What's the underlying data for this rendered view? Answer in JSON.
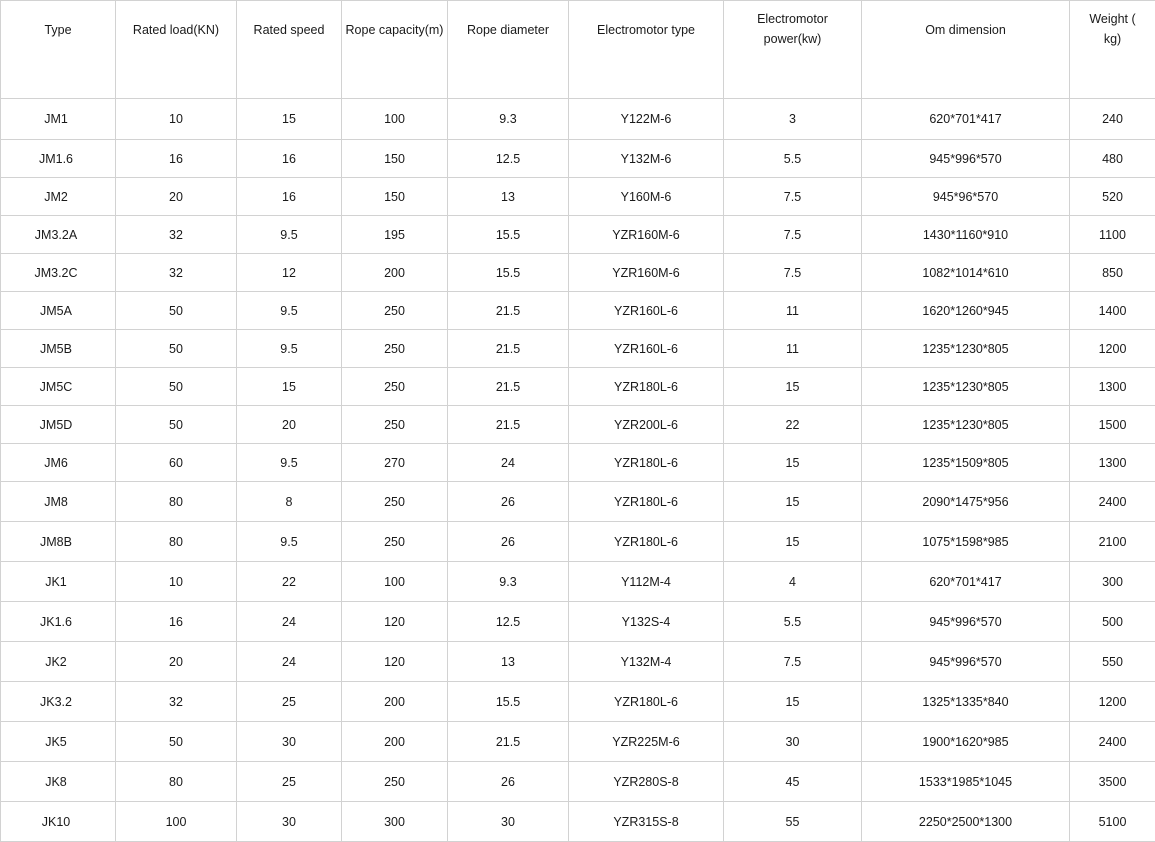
{
  "table": {
    "headers": [
      "Type",
      "Rated load(KN)",
      "Rated speed",
      "Rope capacity(m)",
      "Rope diameter",
      "Electromotor type",
      "Electromotor power(kw)",
      "Om dimension",
      "Weight ( kg)"
    ],
    "rows": [
      [
        "JM1",
        "10",
        "15",
        "100",
        "9.3",
        "Y122M-6",
        "3",
        "620*701*417",
        "240"
      ],
      [
        "JM1.6",
        "16",
        "16",
        "150",
        "12.5",
        "Y132M-6",
        "5.5",
        "945*996*570",
        "480"
      ],
      [
        "JM2",
        "20",
        "16",
        "150",
        "13",
        "Y160M-6",
        "7.5",
        "945*96*570",
        "520"
      ],
      [
        "JM3.2A",
        "32",
        "9.5",
        "195",
        "15.5",
        "YZR160M-6",
        "7.5",
        "1430*1160*910",
        "1100"
      ],
      [
        "JM3.2C",
        "32",
        "12",
        "200",
        "15.5",
        "YZR160M-6",
        "7.5",
        "1082*1014*610",
        "850"
      ],
      [
        "JM5A",
        "50",
        "9.5",
        "250",
        "21.5",
        "YZR160L-6",
        "11",
        "1620*1260*945",
        "1400"
      ],
      [
        "JM5B",
        "50",
        "9.5",
        "250",
        "21.5",
        "YZR160L-6",
        "11",
        "1235*1230*805",
        "1200"
      ],
      [
        "JM5C",
        "50",
        "15",
        "250",
        "21.5",
        "YZR180L-6",
        "15",
        "1235*1230*805",
        "1300"
      ],
      [
        "JM5D",
        "50",
        "20",
        "250",
        "21.5",
        "YZR200L-6",
        "22",
        "1235*1230*805",
        "1500"
      ],
      [
        "JM6",
        "60",
        "9.5",
        "270",
        "24",
        "YZR180L-6",
        "15",
        "1235*1509*805",
        "1300"
      ],
      [
        "JM8",
        "80",
        "8",
        "250",
        "26",
        "YZR180L-6",
        "15",
        "2090*1475*956",
        "2400"
      ],
      [
        "JM8B",
        "80",
        "9.5",
        "250",
        "26",
        "YZR180L-6",
        "15",
        "1075*1598*985",
        "2100"
      ],
      [
        "JK1",
        "10",
        "22",
        "100",
        "9.3",
        "Y112M-4",
        "4",
        "620*701*417",
        "300"
      ],
      [
        "JK1.6",
        "16",
        "24",
        "120",
        "12.5",
        "Y132S-4",
        "5.5",
        "945*996*570",
        "500"
      ],
      [
        "JK2",
        "20",
        "24",
        "120",
        "13",
        "Y132M-4",
        "7.5",
        "945*996*570",
        "550"
      ],
      [
        "JK3.2",
        "32",
        "25",
        "200",
        "15.5",
        "YZR180L-6",
        "15",
        "1325*1335*840",
        "1200"
      ],
      [
        "JK5",
        "50",
        "30",
        "200",
        "21.5",
        "YZR225M-6",
        "30",
        "1900*1620*985",
        "2400"
      ],
      [
        "JK8",
        "80",
        "25",
        "250",
        "26",
        "YZR280S-8",
        "45",
        "1533*1985*1045",
        "3500"
      ],
      [
        "JK10",
        "100",
        "30",
        "300",
        "30",
        "YZR315S-8",
        "55",
        "2250*2500*1300",
        "5100"
      ]
    ]
  }
}
